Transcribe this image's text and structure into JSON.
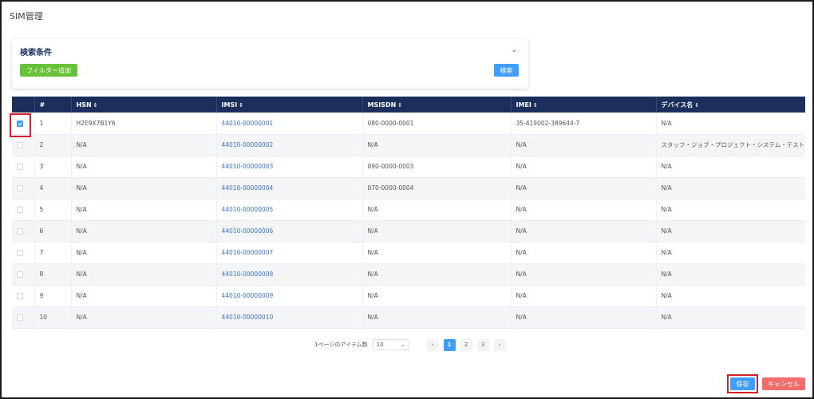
{
  "page": {
    "title": "SIM管理"
  },
  "search": {
    "title": "検索条件",
    "add_filter_label": "フィルター追加",
    "search_label": "検索",
    "chevron": "⌄"
  },
  "table": {
    "columns": [
      {
        "label": "#",
        "sortable": false
      },
      {
        "label": "HSN",
        "sortable": true
      },
      {
        "label": "IMSI",
        "sortable": true
      },
      {
        "label": "MSISDN",
        "sortable": true
      },
      {
        "label": "IMEI",
        "sortable": true
      },
      {
        "label": "デバイス名",
        "sortable": true
      }
    ],
    "sort_icon": "⇕",
    "rows": [
      {
        "checked": true,
        "num": "1",
        "hsn": "H2E9X7B1Y6",
        "imsi": "44010-00000001",
        "msisdn": "080-0000-0001",
        "imei": "35-419002-389644-7",
        "device": "N/A"
      },
      {
        "checked": false,
        "num": "2",
        "hsn": "N/A",
        "imsi": "44010-00000002",
        "msisdn": "N/A",
        "imei": "N/A",
        "device": "スタッフ・ジョブ・プロジェクト・システム・テスト"
      },
      {
        "checked": false,
        "num": "3",
        "hsn": "N/A",
        "imsi": "44010-00000003",
        "msisdn": "090-0000-0003",
        "imei": "N/A",
        "device": "N/A"
      },
      {
        "checked": false,
        "num": "4",
        "hsn": "N/A",
        "imsi": "44010-00000004",
        "msisdn": "070-0000-0004",
        "imei": "N/A",
        "device": "N/A"
      },
      {
        "checked": false,
        "num": "5",
        "hsn": "N/A",
        "imsi": "44010-00000005",
        "msisdn": "N/A",
        "imei": "N/A",
        "device": "N/A"
      },
      {
        "checked": false,
        "num": "6",
        "hsn": "N/A",
        "imsi": "44010-00000006",
        "msisdn": "N/A",
        "imei": "N/A",
        "device": "N/A"
      },
      {
        "checked": false,
        "num": "7",
        "hsn": "N/A",
        "imsi": "44010-00000007",
        "msisdn": "N/A",
        "imei": "N/A",
        "device": "N/A"
      },
      {
        "checked": false,
        "num": "8",
        "hsn": "N/A",
        "imsi": "44010-00000008",
        "msisdn": "N/A",
        "imei": "N/A",
        "device": "N/A"
      },
      {
        "checked": false,
        "num": "9",
        "hsn": "N/A",
        "imsi": "44010-00000009",
        "msisdn": "N/A",
        "imei": "N/A",
        "device": "N/A"
      },
      {
        "checked": false,
        "num": "10",
        "hsn": "N/A",
        "imsi": "44010-00000010",
        "msisdn": "N/A",
        "imei": "N/A",
        "device": "N/A"
      }
    ]
  },
  "pagination": {
    "per_page_label": "1ページのアイテム数",
    "per_page_value": "10",
    "dropdown_icon": "⌄",
    "prev": "‹",
    "next": "›",
    "pages": [
      "1",
      "2",
      "3"
    ],
    "current": "1"
  },
  "footer": {
    "save_label": "保存",
    "cancel_label": "キャンセル"
  },
  "colors": {
    "header_bg": "#1c2e5c",
    "accent_blue": "#409eff",
    "success_green": "#67c23a",
    "danger_red": "#f56c6c",
    "highlight_red": "#d8202a"
  }
}
